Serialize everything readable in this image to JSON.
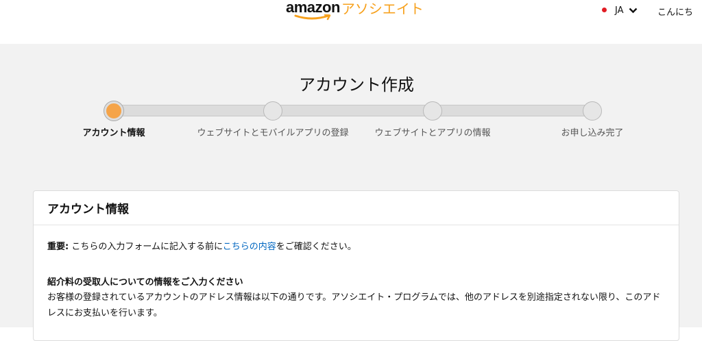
{
  "header": {
    "logo_word": "amazon",
    "logo_suffix": "アソシエイト",
    "language": "JA",
    "greeting": "こんにち"
  },
  "page": {
    "title": "アカウント作成"
  },
  "stepper": {
    "current_step": 1,
    "steps": [
      {
        "label": "アカウント情報"
      },
      {
        "label": "ウェブサイトとモバイルアプリの登録"
      },
      {
        "label": "ウェブサイトとアプリの情報"
      },
      {
        "label": "お申し込み完了"
      }
    ]
  },
  "card": {
    "title": "アカウント情報",
    "notice_prefix": "重要:",
    "notice_text1": " こちらの入力フォームに記入する前に",
    "notice_link": "こちらの内容",
    "notice_text2": "をご確認ください。",
    "section_heading": "紹介料の受取人についての情報をご入力ください",
    "section_body": "お客様の登録されているアカウントのアドレス情報は以下の通りです。アソシエイト・プログラムでは、他のアドレスを別途指定されない限り、このアドレスにお支払いを行います。"
  },
  "colors": {
    "brand_orange": "#f7a11d",
    "active_step": "#f5a449",
    "link": "#0066c0",
    "page_background": "#f2f2f2",
    "flag_red": "#e11c24"
  }
}
